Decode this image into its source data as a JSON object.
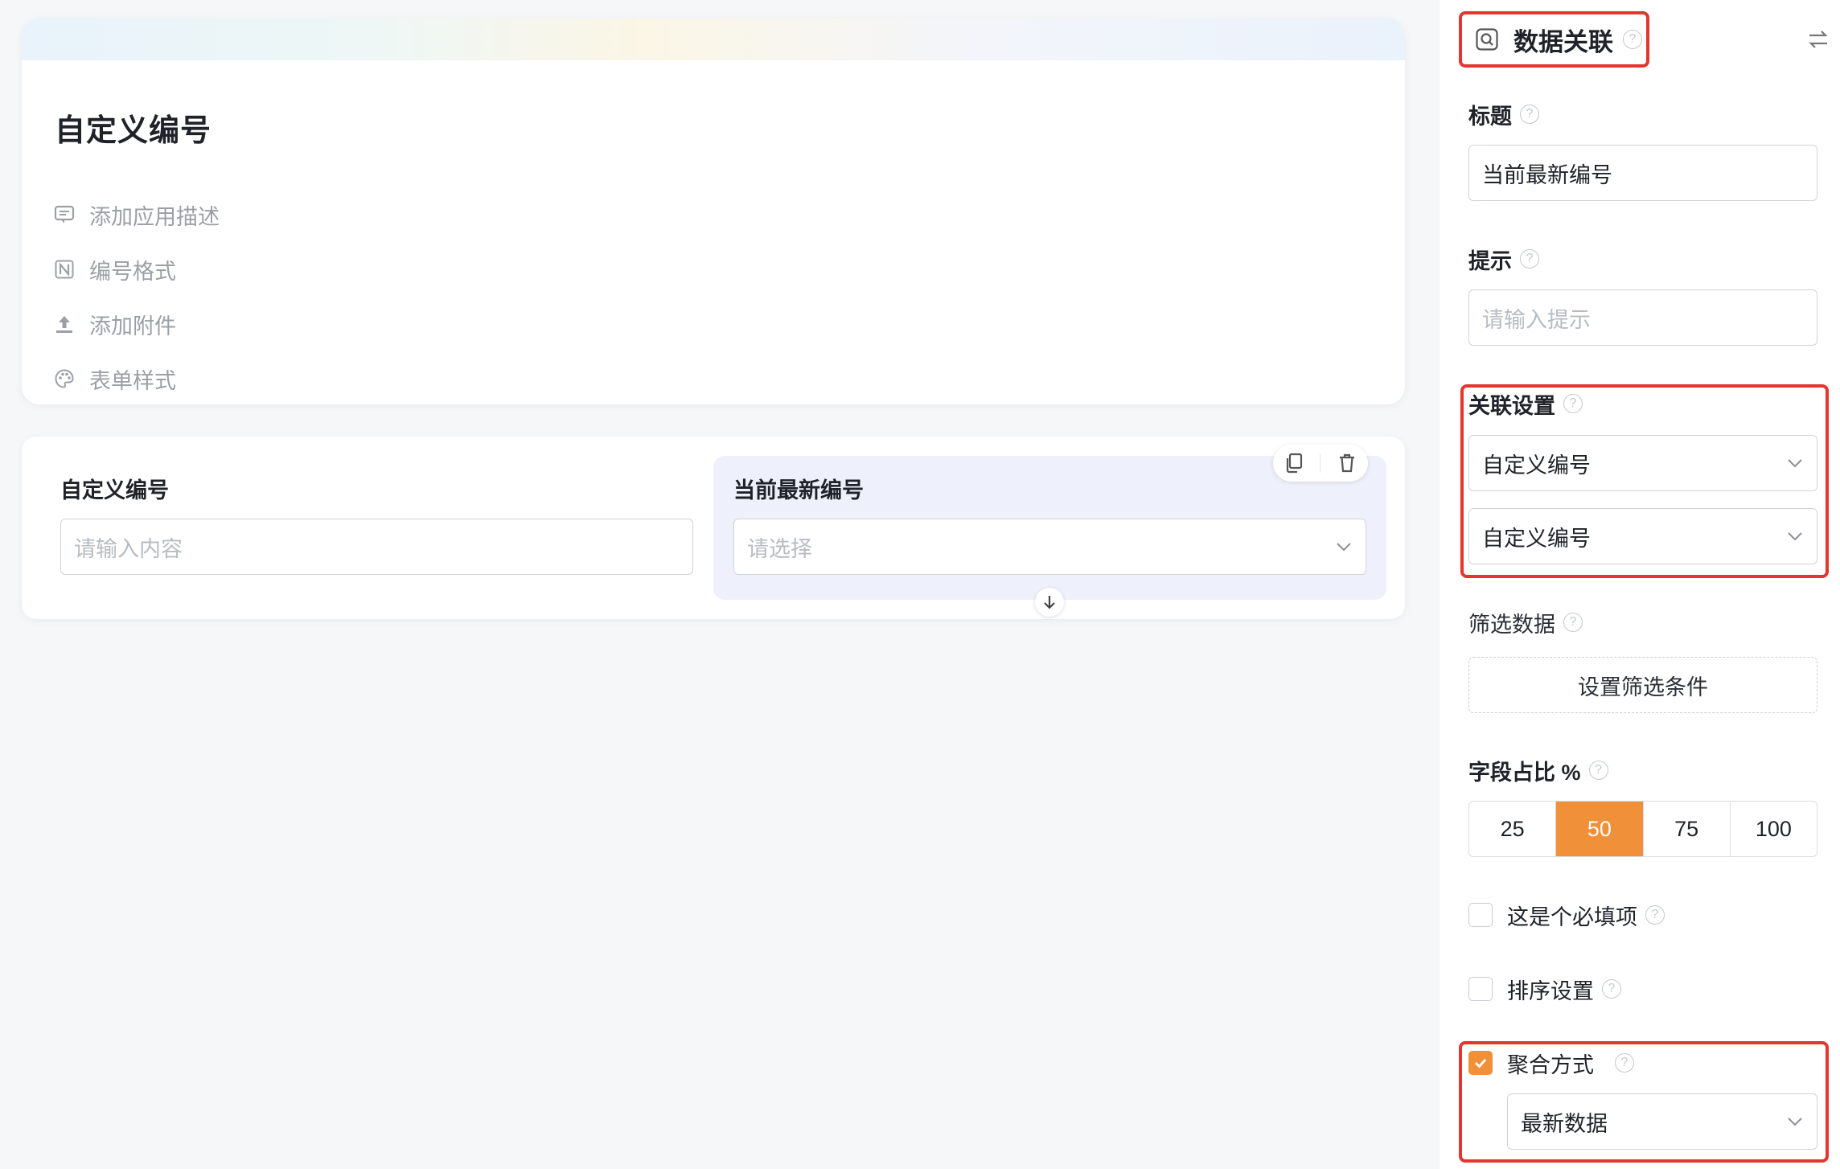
{
  "app": {
    "title": "自定义编号",
    "meta": [
      {
        "label": "添加应用描述",
        "icon": "comment-icon"
      },
      {
        "label": "编号格式",
        "icon": "number-format-icon"
      },
      {
        "label": "添加附件",
        "icon": "upload-icon"
      },
      {
        "label": "表单样式",
        "icon": "palette-icon"
      }
    ]
  },
  "form": {
    "field1": {
      "label": "自定义编号",
      "placeholder": "请输入内容"
    },
    "field2": {
      "label": "当前最新编号",
      "placeholder": "请选择"
    }
  },
  "panel": {
    "component_type": "数据关联",
    "title": {
      "label": "标题",
      "value": "当前最新编号"
    },
    "hint": {
      "label": "提示",
      "placeholder": "请输入提示"
    },
    "association": {
      "label": "关联设置",
      "select1": "自定义编号",
      "select2": "自定义编号"
    },
    "filter": {
      "label": "筛选数据",
      "button": "设置筛选条件"
    },
    "ratio": {
      "label": "字段占比 %",
      "options": [
        "25",
        "50",
        "75",
        "100"
      ],
      "selected": "50"
    },
    "required": {
      "label": "这是个必填项",
      "checked": false
    },
    "sort": {
      "label": "排序设置",
      "checked": false
    },
    "aggregation": {
      "label": "聚合方式",
      "checked": true,
      "value": "最新数据"
    }
  },
  "colors": {
    "accent": "#f0913a",
    "highlight_border": "#e4352f",
    "field_selected_bg": "#eef1fb"
  }
}
